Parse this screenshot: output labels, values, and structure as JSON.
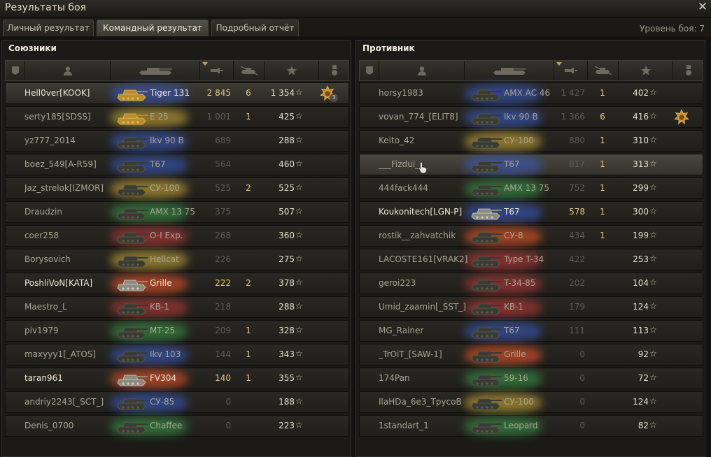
{
  "window": {
    "title": "Результаты боя",
    "close_icon": "close-icon"
  },
  "tabs": [
    {
      "label": "Личный результат",
      "active": false
    },
    {
      "label": "Командный результат",
      "active": true
    },
    {
      "label": "Подробный отчёт",
      "active": false
    }
  ],
  "battle_level": {
    "label": "Уровень боя:",
    "value": "7"
  },
  "columns": [
    {
      "icon": "squad-icon"
    },
    {
      "icon": "player-icon"
    },
    {
      "icon": "tank-icon"
    },
    {
      "icon": "damage-icon",
      "sorted": true
    },
    {
      "icon": "kills-icon"
    },
    {
      "icon": "experience-star-icon"
    },
    {
      "icon": "medal-icon"
    }
  ],
  "colors": {
    "heavy": "#3a5fd0",
    "medium": "#c83a3a",
    "td": "#d8b43a",
    "light": "#3aa04a",
    "spg": "#ff5a2a",
    "gold_text": "#e8c77e"
  },
  "allies": {
    "title": "Союзники",
    "rows": [
      {
        "name": "Hell0ver[KOOK]",
        "tank": "Tiger 131",
        "damage": "2 845",
        "kills": "6",
        "xp": "1 354",
        "star": "☆",
        "medal": "3",
        "me": true,
        "glow": "#3a5fd0",
        "tank_icon": "tank-silhouette-gold"
      },
      {
        "name": "serty185[SDSS]",
        "tank": "E 25",
        "damage": "1 001",
        "kills": "1",
        "xp": "425",
        "star": "☆",
        "glow": "#d8b43a",
        "tank_icon": "tank-silhouette-gold"
      },
      {
        "name": "yz777_2014",
        "tank": "Ikv 90 B",
        "damage": "689",
        "kills": "",
        "xp": "288",
        "star": "☆",
        "glow": "#3a5fd0",
        "tank_icon": "tank-silhouette"
      },
      {
        "name": "boez_549[A-R59]",
        "tank": "T67",
        "damage": "564",
        "kills": "",
        "xp": "460",
        "star": "☆",
        "glow": "#3a5fd0",
        "tank_icon": "tank-silhouette"
      },
      {
        "name": "Jaz_strelok[IZMOR]",
        "tank": "СУ-100",
        "damage": "525",
        "kills": "2",
        "xp": "525",
        "star": "☆",
        "glow": "#d8b43a",
        "tank_icon": "tank-silhouette"
      },
      {
        "name": "Draudzin",
        "tank": "AMX 13 75",
        "damage": "375",
        "kills": "",
        "xp": "507",
        "star": "☆",
        "glow": "#3aa04a",
        "tank_icon": "tank-silhouette"
      },
      {
        "name": "coer258",
        "tank": "O-I Exp.",
        "damage": "268",
        "kills": "",
        "xp": "360",
        "star": "☆",
        "glow": "#c83a3a",
        "tank_icon": "tank-silhouette"
      },
      {
        "name": "Borysovich",
        "tank": "Hellcat",
        "damage": "226",
        "kills": "",
        "xp": "275",
        "star": "☆",
        "glow": "#d8b43a",
        "tank_icon": "tank-silhouette"
      },
      {
        "name": "PoshliVoN[KATA]",
        "tank": "Grille",
        "damage": "222",
        "kills": "2",
        "xp": "378",
        "star": "☆",
        "bright": true,
        "glow": "#ff5a2a",
        "tank_icon": "tank-silhouette-light"
      },
      {
        "name": "Maestro_L",
        "tank": "KB-1",
        "damage": "218",
        "kills": "",
        "xp": "288",
        "star": "☆",
        "glow": "#c83a3a",
        "tank_icon": "tank-silhouette"
      },
      {
        "name": "piv1979",
        "tank": "MT-25",
        "damage": "209",
        "kills": "1",
        "xp": "328",
        "star": "☆",
        "glow": "#3aa04a",
        "tank_icon": "tank-silhouette"
      },
      {
        "name": "maxyyy1[_ATOS]",
        "tank": "Ikv 103",
        "damage": "144",
        "kills": "1",
        "xp": "343",
        "star": "☆",
        "glow": "#3a5fd0",
        "tank_icon": "tank-silhouette"
      },
      {
        "name": "taran961",
        "tank": "FV304",
        "damage": "140",
        "kills": "1",
        "xp": "355",
        "star": "☆",
        "bright": true,
        "glow": "#ff5a2a",
        "tank_icon": "tank-silhouette-light"
      },
      {
        "name": "andriy2243[_SCT_]",
        "tank": "СУ-85",
        "damage": "0",
        "kills": "",
        "xp": "188",
        "star": "☆",
        "glow": "#3a5fd0",
        "tank_icon": "tank-silhouette"
      },
      {
        "name": "Denis_0700",
        "tank": "Chaffee",
        "damage": "0",
        "kills": "",
        "xp": "223",
        "star": "☆",
        "glow": "#3aa04a",
        "tank_icon": "tank-silhouette"
      }
    ]
  },
  "enemies": {
    "title": "Противник",
    "rows": [
      {
        "name": "horsy1983",
        "tank": "AMX AC 46",
        "damage": "1 427",
        "kills": "1",
        "xp": "402",
        "star": "☆",
        "glow": "#3a5fd0",
        "tank_icon": "tank-silhouette"
      },
      {
        "name": "vovan_774_[ELIT8]",
        "tank": "Ikv 90 B",
        "damage": "1 366",
        "kills": "6",
        "xp": "416",
        "star": "☆",
        "medal": "",
        "glow": "#3a5fd0",
        "tank_icon": "tank-silhouette"
      },
      {
        "name": "Keito_42",
        "tank": "СУ-100",
        "damage": "880",
        "kills": "1",
        "xp": "310",
        "star": "☆",
        "glow": "#d8b43a",
        "tank_icon": "tank-silhouette"
      },
      {
        "name": "___Fizdui___",
        "tank": "T67",
        "damage": "817",
        "kills": "1",
        "xp": "313",
        "star": "☆",
        "hover": true,
        "glow": "#3a5fd0",
        "tank_icon": "tank-silhouette"
      },
      {
        "name": "444fack444",
        "tank": "AMX 13 75",
        "damage": "752",
        "kills": "1",
        "xp": "299",
        "star": "☆",
        "glow": "#3aa04a",
        "tank_icon": "tank-silhouette"
      },
      {
        "name": "Koukonitech[LGN-P]",
        "tank": "T67",
        "damage": "578",
        "kills": "1",
        "xp": "300",
        "star": "☆",
        "bright": true,
        "glow": "#3a5fd0",
        "tank_icon": "tank-silhouette-light"
      },
      {
        "name": "rostik__zahvatchik",
        "tank": "СУ-8",
        "damage": "434",
        "kills": "1",
        "xp": "199",
        "star": "☆",
        "glow": "#ff5a2a",
        "tank_icon": "tank-silhouette"
      },
      {
        "name": "LACOSTE161[VRAK2]",
        "tank": "Type T-34",
        "damage": "422",
        "kills": "",
        "xp": "253",
        "star": "☆",
        "glow": "#c83a3a",
        "tank_icon": "tank-silhouette"
      },
      {
        "name": "geroi223",
        "tank": "T-34-85",
        "damage": "202",
        "kills": "",
        "xp": "104",
        "star": "☆",
        "glow": "#c83a3a",
        "tank_icon": "tank-silhouette"
      },
      {
        "name": "Umid_zaamin[_SST_]",
        "tank": "KB-1",
        "damage": "179",
        "kills": "",
        "xp": "124",
        "star": "☆",
        "glow": "#c83a3a",
        "tank_icon": "tank-silhouette"
      },
      {
        "name": "MG_Rainer",
        "tank": "T67",
        "damage": "111",
        "kills": "",
        "xp": "113",
        "star": "☆",
        "glow": "#3a5fd0",
        "tank_icon": "tank-silhouette"
      },
      {
        "name": "_TrOiT_[SAW-1]",
        "tank": "Grille",
        "damage": "0",
        "kills": "",
        "xp": "92",
        "star": "☆",
        "glow": "#ff5a2a",
        "tank_icon": "tank-silhouette"
      },
      {
        "name": "174Pan",
        "tank": "59-16",
        "damage": "0",
        "kills": "",
        "xp": "72",
        "star": "☆",
        "glow": "#3aa04a",
        "tank_icon": "tank-silhouette"
      },
      {
        "name": "IlaHDa_6e3_TpycoB",
        "tank": "СУ-100",
        "damage": "0",
        "kills": "",
        "xp": "124",
        "star": "☆",
        "glow": "#d8b43a",
        "tank_icon": "tank-silhouette"
      },
      {
        "name": "1standart_1",
        "tank": "Leopard",
        "damage": "0",
        "kills": "",
        "xp": "82",
        "star": "☆",
        "glow": "#3aa04a",
        "tank_icon": "tank-silhouette"
      }
    ]
  }
}
